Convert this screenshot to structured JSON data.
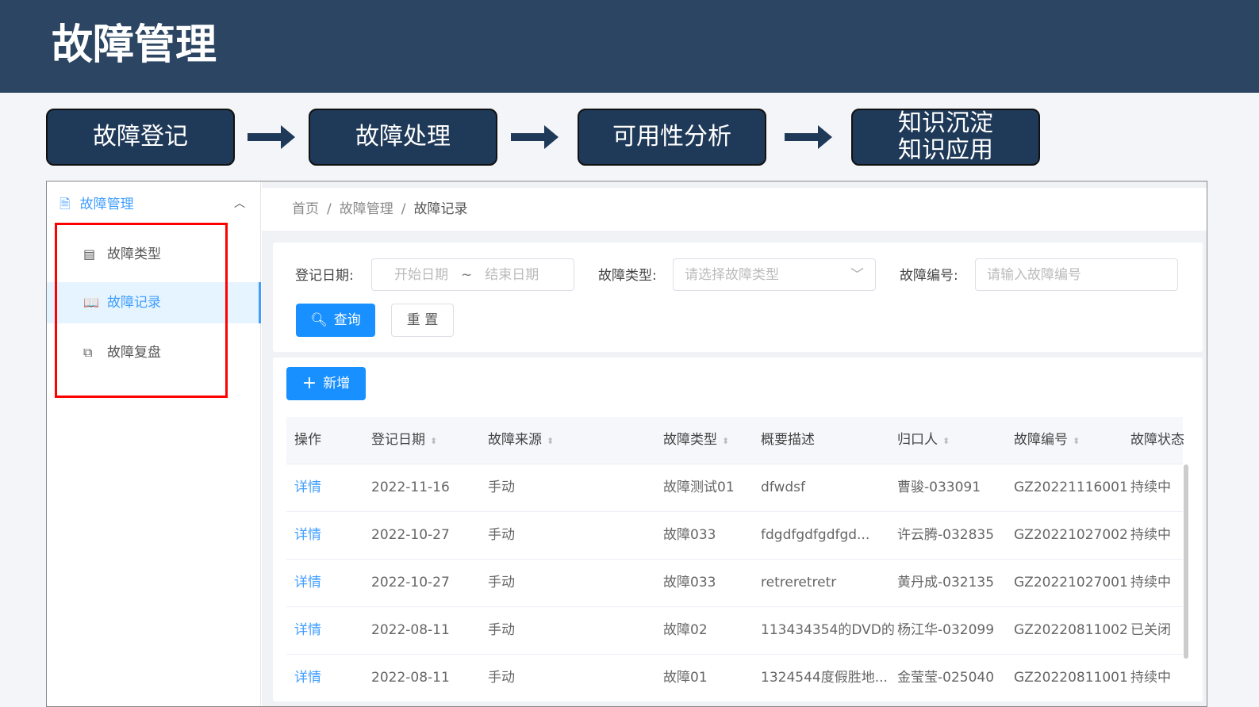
{
  "title": "故障管理",
  "flow": [
    "故障登记",
    "故障处理",
    "可用性分析",
    "知识沉淀\n知识应用"
  ],
  "sidebar": {
    "group": "故障管理",
    "items": [
      {
        "label": "故障类型",
        "icon": "form-icon"
      },
      {
        "label": "故障记录",
        "icon": "book-icon",
        "active": true
      },
      {
        "label": "故障复盘",
        "icon": "copy-icon"
      }
    ]
  },
  "breadcrumb": [
    "首页",
    "故障管理",
    "故障记录"
  ],
  "filters": {
    "date_label": "登记日期:",
    "start_placeholder": "开始日期",
    "tilde": "~",
    "end_placeholder": "结束日期",
    "type_label": "故障类型:",
    "type_placeholder": "请选择故障类型",
    "code_label": "故障编号:",
    "code_placeholder": "请输入故障编号",
    "search": "查询",
    "reset": "重 置"
  },
  "add": "新增",
  "table": {
    "headers": [
      "操作",
      "登记日期",
      "故障来源",
      "故障类型",
      "概要描述",
      "归口人",
      "故障编号",
      "故障状态"
    ],
    "rows": [
      [
        "详情",
        "2022-11-16",
        "手动",
        "故障测试01",
        "dfwdsf",
        "曹骏-033091",
        "GZ20221116001",
        "持续中"
      ],
      [
        "详情",
        "2022-10-27",
        "手动",
        "故障033",
        "fdgdfgdfgdfgd...",
        "许云腾-032835",
        "GZ20221027002",
        "持续中"
      ],
      [
        "详情",
        "2022-10-27",
        "手动",
        "故障033",
        "retreretretr",
        "黄丹成-032135",
        "GZ20221027001",
        "持续中"
      ],
      [
        "详情",
        "2022-08-11",
        "手动",
        "故障02",
        "113434354的DVD的",
        "杨江华-032099",
        "GZ20220811002",
        "已关闭"
      ],
      [
        "详情",
        "2022-08-11",
        "手动",
        "故障01",
        "1324544度假胜地...",
        "金莹莹-025040",
        "GZ20220811001",
        "持续中"
      ]
    ]
  }
}
